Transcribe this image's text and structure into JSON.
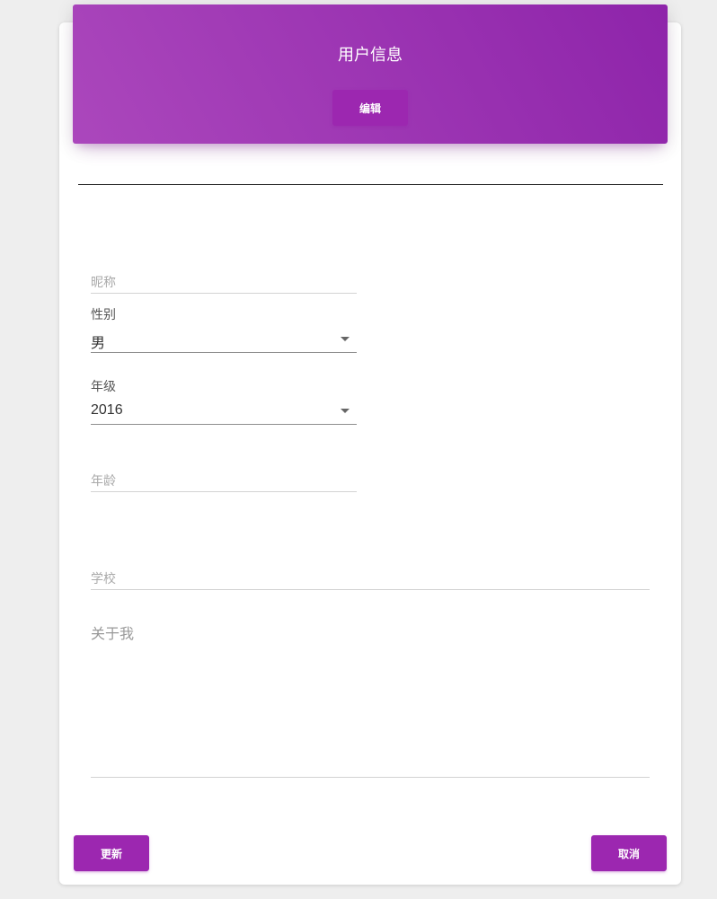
{
  "header": {
    "title": "用户信息",
    "edit_label": "编辑"
  },
  "form": {
    "nickname": {
      "placeholder": "昵称",
      "value": ""
    },
    "gender": {
      "label": "性别",
      "value": "男"
    },
    "grade": {
      "label": "年级",
      "value": "2016"
    },
    "age": {
      "placeholder": "年龄",
      "value": ""
    },
    "school": {
      "placeholder": "学校",
      "value": ""
    },
    "about": {
      "placeholder": "关于我",
      "value": ""
    }
  },
  "actions": {
    "update_label": "更新",
    "cancel_label": "取消"
  },
  "colors": {
    "accent": "#9c27b0",
    "header_gradient_start": "#ab47bc",
    "header_gradient_end": "#8e24aa"
  }
}
